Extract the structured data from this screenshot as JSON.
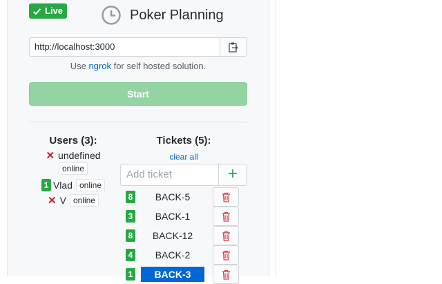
{
  "header": {
    "live_label": "Live",
    "title": "Poker Planning"
  },
  "url_bar": {
    "value": "http://localhost:3000"
  },
  "hint": {
    "prefix": "Use ",
    "link": "ngrok",
    "suffix": " for self hosted solution."
  },
  "start_label": "Start",
  "users": {
    "title": "Users (3):",
    "items": [
      {
        "vote": "",
        "name": "undefined",
        "status": "online"
      },
      {
        "vote": "1",
        "name": "Vlad",
        "status": "online"
      },
      {
        "vote": "",
        "name": "V",
        "status": "online"
      }
    ]
  },
  "tickets": {
    "title": "Tickets (5):",
    "clear_all": "clear all",
    "placeholder": "Add ticket",
    "add_symbol": "+",
    "items": [
      {
        "vote": "8",
        "name": "BACK-5"
      },
      {
        "vote": "3",
        "name": "BACK-1"
      },
      {
        "vote": "8",
        "name": "BACK-12"
      },
      {
        "vote": "4",
        "name": "BACK-2"
      },
      {
        "vote": "1",
        "name": "BACK-3",
        "active": true
      }
    ]
  },
  "colors": {
    "accent": "#28a745",
    "link": "#0366d6",
    "danger": "#cb2431",
    "start_button": "#94d3a2"
  },
  "icons": [
    "check-icon",
    "clock-icon",
    "clipboard-icon",
    "x-icon",
    "plus-icon",
    "trash-icon"
  ]
}
